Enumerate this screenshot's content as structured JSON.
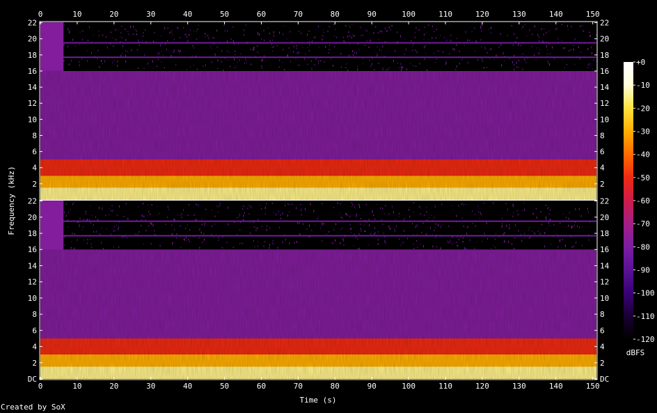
{
  "chart_data": {
    "type": "heatmap",
    "subtype": "spectrogram",
    "xlabel": "Time (s)",
    "ylabel": "Frequency (kHz)",
    "xlim": [
      0,
      151
    ],
    "ylim": [
      0,
      22.05
    ],
    "x_ticks": [
      0,
      10,
      20,
      30,
      40,
      50,
      60,
      70,
      80,
      90,
      100,
      110,
      120,
      130,
      140,
      150
    ],
    "y_tick_labels": [
      "DC",
      "2",
      "4",
      "6",
      "8",
      "10",
      "12",
      "14",
      "16",
      "18",
      "20",
      "22"
    ],
    "y_tick_values": [
      0,
      2,
      4,
      6,
      8,
      10,
      12,
      14,
      16,
      18,
      20,
      22
    ],
    "channels": 2,
    "colorbar": {
      "label": "dBFS",
      "range": [
        -120,
        0
      ],
      "ticks": [
        0,
        -10,
        -20,
        -30,
        -40,
        -50,
        -60,
        -70,
        -80,
        -90,
        -100,
        -110,
        -120
      ],
      "tick_labels": [
        "+0",
        "-10",
        "-20",
        "-30",
        "-40",
        "-50",
        "-60",
        "-70",
        "-80",
        "-90",
        "-100",
        "-110",
        "-120"
      ],
      "colormap": [
        "#000000",
        "#1a0033",
        "#3a0077",
        "#5a1296",
        "#7a1ea2",
        "#a41e86",
        "#cc1c4c",
        "#ee2a12",
        "#ff6a00",
        "#ffae00",
        "#ffe23c",
        "#ffffd8",
        "#ffffff"
      ]
    },
    "observed": {
      "intro_end_s": 6.3,
      "lowpass_khz": 16,
      "tones_khz": [
        19.5,
        17.7
      ],
      "energy_bands_dbfs": [
        {
          "from_khz": 0,
          "to_khz": 1.5,
          "dbfs": -15
        },
        {
          "from_khz": 1.5,
          "to_khz": 3,
          "dbfs": -30
        },
        {
          "from_khz": 3,
          "to_khz": 5,
          "dbfs": -50
        },
        {
          "from_khz": 5,
          "to_khz": 16,
          "dbfs": -78
        },
        {
          "from_khz": 16,
          "to_khz": 22,
          "dbfs": -120
        }
      ]
    }
  },
  "footer": {
    "credit": "Created by SoX"
  }
}
